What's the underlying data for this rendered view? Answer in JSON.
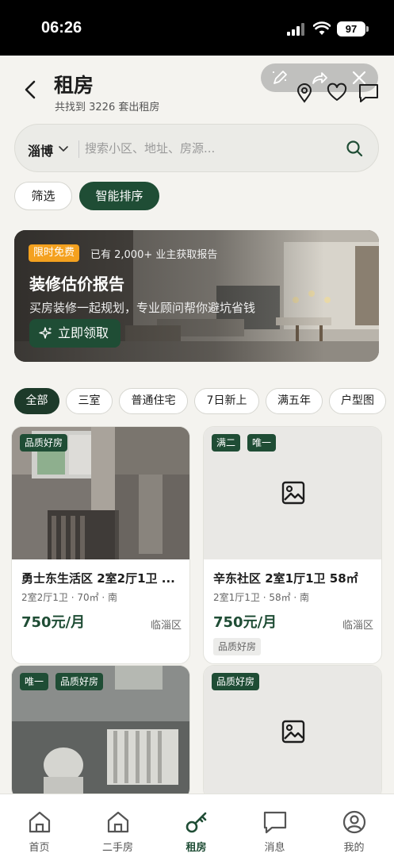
{
  "status_bar": {
    "time": "06:26",
    "battery": "97"
  },
  "header": {
    "title": "租房",
    "result_count": "共找到 3226 套出租房",
    "toolbar_icons": [
      "edit-icon",
      "share-icon",
      "close-icon"
    ],
    "action_icons": [
      "location-pin-icon",
      "heart-icon",
      "message-icon"
    ]
  },
  "search": {
    "city": "淄博",
    "placeholder": "搜索小区、地址、房源..."
  },
  "chips": {
    "filter": "筛选",
    "sort": "智能排序"
  },
  "banner": {
    "free_tag": "限时免费",
    "owners_text": "已有 2,000+ 业主获取报告",
    "title": "装修估价报告",
    "subtitle": "买房装修一起规划，专业顾问帮你避坑省钱",
    "button": "立即领取"
  },
  "tags": [
    "全部",
    "三室",
    "普通住宅",
    "7日新上",
    "满五年",
    "户型图"
  ],
  "listings": [
    {
      "badges": [
        "品质好房"
      ],
      "title": "勇士东生活区 2室2厅1卫 ...",
      "meta": "2室2厅1卫 · 70㎡ · 南",
      "price": "750元/月",
      "district": "临淄区",
      "has_photo": true
    },
    {
      "badges": [
        "满二",
        "唯一"
      ],
      "title": "辛东社区 2室1厅1卫 58㎡",
      "meta": "2室1厅1卫 · 58㎡ · 南",
      "price": "750元/月",
      "district": "临淄区",
      "tag": "品质好房",
      "has_photo": false
    },
    {
      "badges": [
        "唯一",
        "品质好房"
      ],
      "has_photo": true
    },
    {
      "badges": [
        "品质好房"
      ],
      "has_photo": false
    }
  ],
  "nav": [
    {
      "label": "首页",
      "icon": "home-icon",
      "active": false
    },
    {
      "label": "二手房",
      "icon": "house-icon",
      "active": false
    },
    {
      "label": "租房",
      "icon": "key-icon",
      "active": true
    },
    {
      "label": "消息",
      "icon": "chat-icon",
      "active": false
    },
    {
      "label": "我的",
      "icon": "profile-icon",
      "active": false
    }
  ],
  "colors": {
    "brand": "#1f4d35",
    "accent_tag": "#f4a11f",
    "background": "#f4f3ef"
  }
}
